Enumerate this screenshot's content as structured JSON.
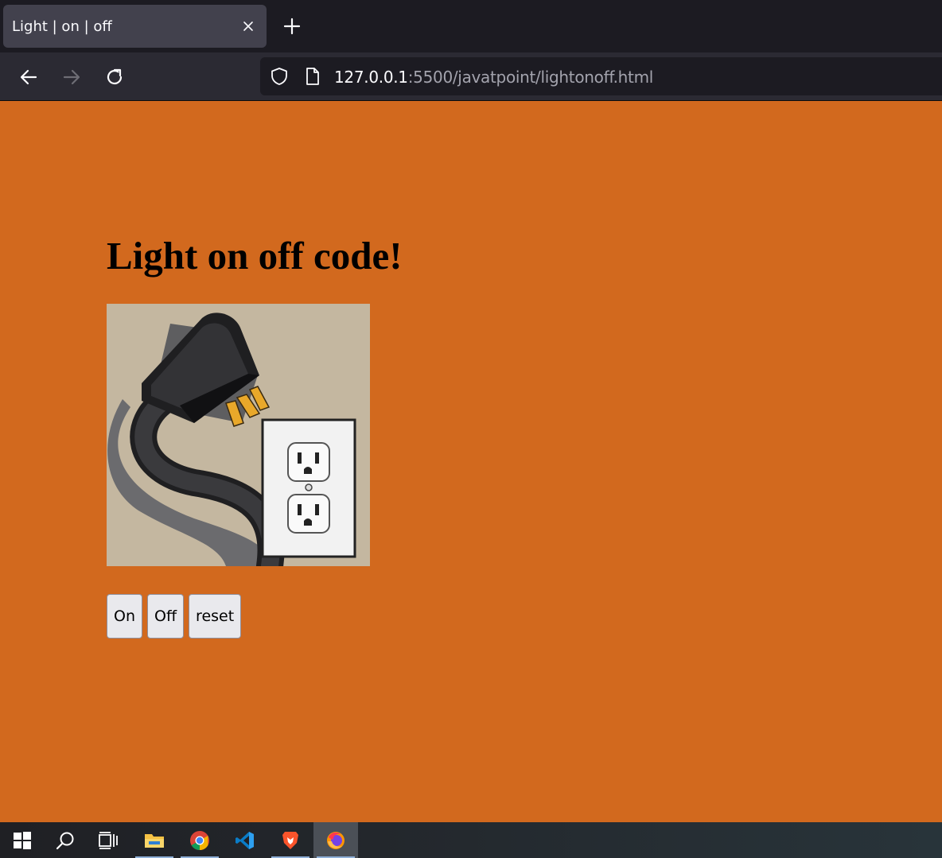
{
  "browser": {
    "tab": {
      "title": "Light | on | off"
    },
    "url": {
      "host": "127.0.0.1",
      "rest": ":5500/javatpoint/lightonoff.html"
    }
  },
  "page": {
    "heading": "Light on off code!",
    "image": {
      "alt": "plug-and-outlet illustration"
    },
    "buttons": {
      "on": "On",
      "off": "Off",
      "reset": "reset"
    },
    "background_color": "#d2691e"
  },
  "taskbar": {
    "items": [
      "start-icon",
      "search-icon",
      "task-view-icon",
      "file-explorer-icon",
      "chrome-icon",
      "vscode-icon",
      "brave-icon",
      "firefox-icon"
    ]
  }
}
